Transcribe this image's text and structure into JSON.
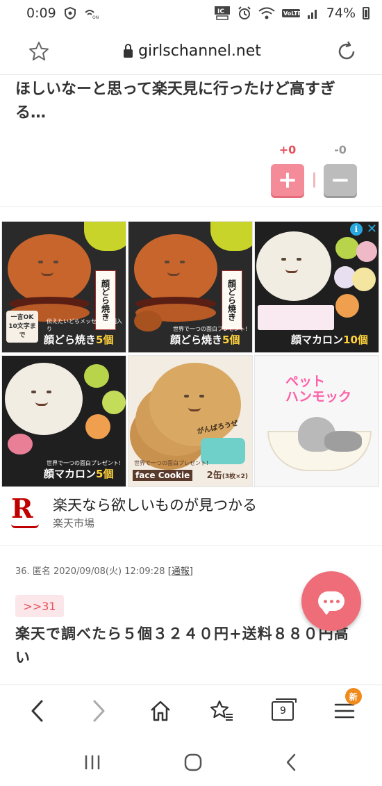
{
  "status_bar": {
    "time": "0:09",
    "battery": "74%",
    "left_icons": [
      "vpn-shield-icon",
      "wifi-calling-icon"
    ],
    "right_icons": [
      "ic-card-icon",
      "alarm-icon",
      "wifi-icon",
      "volte-icon",
      "signal-icon",
      "battery-icon"
    ]
  },
  "browser": {
    "url": "girlschannel.net",
    "bookmark_icon": "star-icon",
    "reload_icon": "reload-icon"
  },
  "comment_prev": {
    "text": "ほしいなーと思って楽天見に行ったけど高すぎる…",
    "plus_count": "+0",
    "minus_count": "-0",
    "plus_symbol": "+",
    "minus_symbol": "−"
  },
  "ad": {
    "tiles": [
      {
        "caption": "顔どら焼き",
        "count": "5個",
        "sub": "伝えたいどらメッセージ1個入り",
        "box": "顔どら焼き",
        "note": "一言OK 10文字まで"
      },
      {
        "caption": "顔どら焼き",
        "count": "5個",
        "sub": "世界で一つの面白プレゼント!",
        "box": "顔どら焼き"
      },
      {
        "caption": "顔マカロン",
        "count": "10個"
      },
      {
        "caption": "顔マカロン",
        "count": "5個",
        "sub": "世界で一つの面白プレゼント!"
      },
      {
        "label": "face Cookie",
        "count": "2缶",
        "count_sub": "(3枚×2)",
        "sub": "世界で一つの面白プレゼント!",
        "msg": "がんばろうぜ"
      },
      {
        "title_line1": "ペット",
        "title_line2": "ハンモック"
      }
    ],
    "advertiser_title": "楽天なら欲しいものが見つかる",
    "advertiser_sub": "楽天市場",
    "logo_letter": "R",
    "info_symbol": "i",
    "close_symbol": "✕"
  },
  "comment_36": {
    "number": "36.",
    "name": "匿名",
    "date": "2020/09/08(火) 12:09:28",
    "report": "[通報]",
    "anchor": ">>31",
    "text": "楽天で調べたら５個３２４０円+送料８８０円高い"
  },
  "toolbar": {
    "items": [
      "back-icon",
      "forward-icon",
      "home-icon",
      "bookmarks-icon",
      "tabs-icon",
      "menu-icon"
    ],
    "tabs_count": "9",
    "new_badge": "新"
  },
  "nav": [
    "recent-apps-icon",
    "home-circle-icon",
    "back-nav-icon"
  ]
}
